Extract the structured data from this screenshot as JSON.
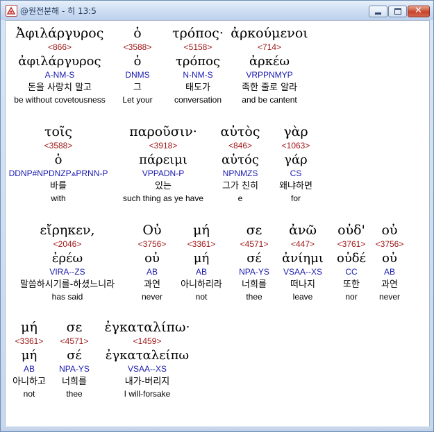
{
  "window": {
    "title": "@원전분해 - 히 13:5",
    "controls": {
      "minimize": "minimize",
      "maximize": "maximize",
      "close": "✕"
    }
  },
  "colors": {
    "strong": "#a01818",
    "parse": "#1a1ab0",
    "text": "#000000",
    "highlight_bg": "#ffffff"
  },
  "verse": [
    {
      "surface": "Ἀφιλάργυρος",
      "strong": "<866>",
      "lemma": "ἀφιλάργυρος",
      "parse": "A-NM-S",
      "korean": "돈을 사랑치 말고",
      "english": "be without covetousness"
    },
    {
      "surface": "ὁ",
      "strong": "<3588>",
      "lemma": "ὁ",
      "parse": "DNMS",
      "korean": "그",
      "english": "Let your"
    },
    {
      "surface": "τρόπος·",
      "strong": "<5158>",
      "lemma": "τρόπος",
      "parse": "N-NM-S",
      "korean": "태도가",
      "english": "conversation"
    },
    {
      "surface": "ἀρκούμενοι",
      "strong": "<714>",
      "lemma": "ἀρκέω",
      "parse": "VRPPNMYP",
      "korean": "족한 줄로 알라",
      "english": "and be cantent"
    },
    {
      "surface": "τοῖς",
      "strong": "<3588>",
      "lemma": "ὁ",
      "parse": "DDNP#NPDNZP⩓PRNN-P",
      "korean": "바를",
      "english": "with"
    },
    {
      "surface": "παροῦσιν·",
      "strong": "<3918>",
      "lemma": "πάρειμι",
      "parse": "VPPADN-P",
      "korean": "있는",
      "english": "such thing as ye have"
    },
    {
      "surface": "αὐτὸς",
      "strong": "<846>",
      "lemma": "αὐτός",
      "parse": "NPNMZS",
      "korean": "그가 친히",
      "english": "e"
    },
    {
      "surface": "γὰρ",
      "strong": "<1063>",
      "lemma": "γάρ",
      "parse": "CS",
      "korean": "왜냐하면",
      "english": "for"
    },
    {
      "surface": "εἴρηκεν,",
      "strong": "<2046>",
      "lemma": "ἐρέω",
      "parse": "VIRA--ZS",
      "korean": "말씀하시기를-하셨느니라",
      "english": "has said"
    },
    {
      "surface": "Οὐ",
      "strong": "<3756>",
      "lemma": "οὐ",
      "parse": "AB",
      "korean": "과연",
      "english": "never"
    },
    {
      "surface": "μή",
      "strong": "<3361>",
      "lemma": "μή",
      "parse": "AB",
      "korean": "아니하리라",
      "english": "not"
    },
    {
      "surface": "σε",
      "strong": "<4571>",
      "lemma": "σέ",
      "parse": "NPA-YS",
      "korean": "너희를",
      "english": "thee"
    },
    {
      "surface": "ἀνῶ",
      "strong": "<447>",
      "lemma": "ἀνίημι",
      "parse": "VSAA--XS",
      "korean": "떠나지",
      "english": "leave"
    },
    {
      "surface": "οὐδ'",
      "strong": "<3761>",
      "lemma": "οὐδέ",
      "parse": "CC",
      "korean": "또한",
      "english": "nor"
    },
    {
      "surface": "οὐ",
      "strong": "<3756>",
      "lemma": "οὐ",
      "parse": "AB",
      "korean": "과연",
      "english": "never"
    },
    {
      "surface": "μή",
      "strong": "<3361>",
      "lemma": "μή",
      "parse": "AB",
      "korean": "아니하고",
      "english": "not"
    },
    {
      "surface": "σε",
      "strong": "<4571>",
      "lemma": "σέ",
      "parse": "NPA-YS",
      "korean": "너희를",
      "english": "thee"
    },
    {
      "surface": "ἐγκαταλίπω·",
      "strong": "<1459>",
      "lemma": "ἐγκαταλείπω",
      "parse": "VSAA--XS",
      "korean": "내가-버리지",
      "english": "I will-forsake"
    }
  ]
}
